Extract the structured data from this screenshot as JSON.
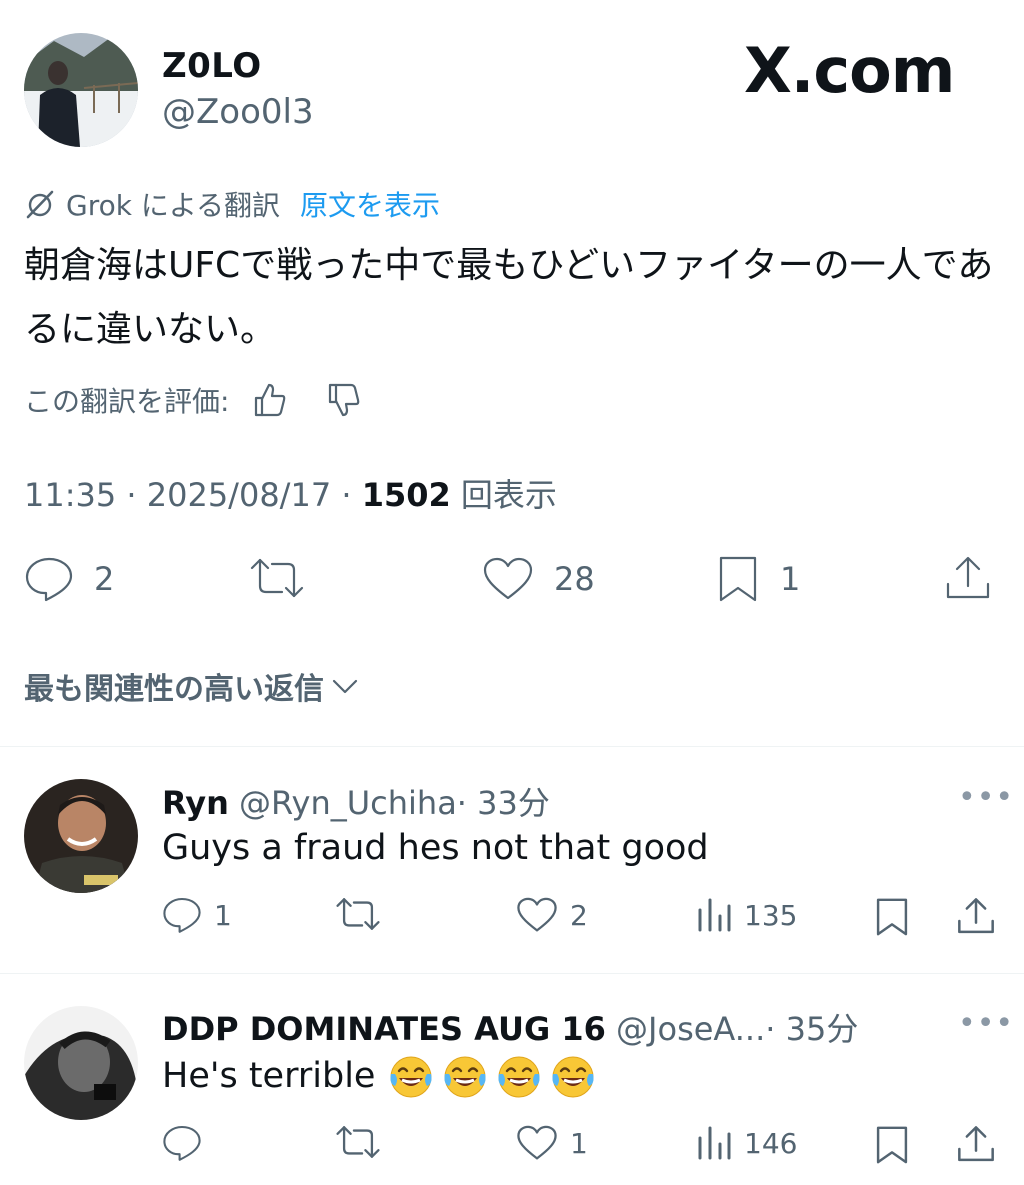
{
  "tweet": {
    "author_name": "Z0LO",
    "author_handle": "@Zoo0l3",
    "brand": "X.com",
    "translated_by": "Grok による翻訳",
    "show_original": "原文を表示",
    "body": "朝倉海はUFCで戦った中で最もひどいファイターの一人であるに違いない。",
    "rate_label": "この翻訳を評価:",
    "time": "11:35 · 2025/08/17 · ",
    "views": "1502",
    "views_label": " 回表示",
    "stats": {
      "replies": "2",
      "reposts": "",
      "likes": "28",
      "bookmarks": "1"
    },
    "replies_sort": "最も関連性の高い返信"
  },
  "replies": [
    {
      "name": "Ryn",
      "handle": "@Ryn_Uchiha",
      "time": "· 33分",
      "text": "Guys a fraud hes not that good",
      "stats": {
        "replies": "1",
        "reposts": "",
        "likes": "2",
        "views": "135"
      }
    },
    {
      "name": "DDP DOMINATES AUG 16",
      "handle": "@JoseA...",
      "time": "· 35分",
      "text": "He's terrible ",
      "stats": {
        "replies": "",
        "reposts": "",
        "likes": "1",
        "views": "146"
      }
    }
  ],
  "more_label": "•••",
  "colors": {
    "accent": "#1d9bf0",
    "text": "#0f1419",
    "muted": "#536471",
    "divider": "#eff3f4"
  },
  "icons": [
    "reply-icon",
    "repost-icon",
    "like-icon",
    "bookmark-icon",
    "share-icon",
    "views-icon",
    "thumbs-up-icon",
    "thumbs-down-icon",
    "grok-icon",
    "chevron-down-icon",
    "laughing-emoji-icon"
  ]
}
